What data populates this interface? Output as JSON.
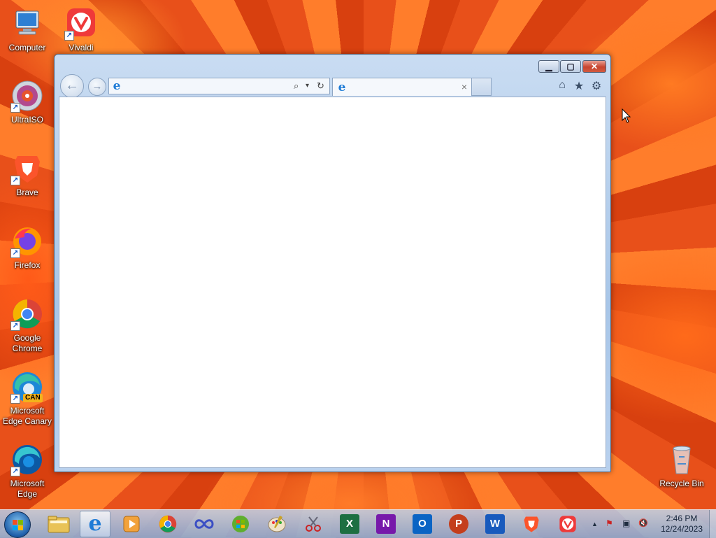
{
  "desktop": {
    "icons": [
      {
        "label": "Computer"
      },
      {
        "label": "Vivaldi"
      },
      {
        "label": "UltraISO"
      },
      {
        "label": "Brave"
      },
      {
        "label": "Firefox"
      },
      {
        "label": "Google Chrome"
      },
      {
        "label": "Microsoft Edge Canary",
        "badge": "CAN"
      },
      {
        "label": "Microsoft Edge"
      },
      {
        "label": "Recycle Bin"
      }
    ]
  },
  "browser": {
    "address_value": "",
    "tab_title": "",
    "new_tab_label": "",
    "buttons": {
      "minimize": "▁",
      "maximize": "▢",
      "close": "✕",
      "back": "←",
      "forward": "→",
      "search": "⌕",
      "dropdown": "▾",
      "refresh": "↻",
      "tab_close": "×",
      "home": "⌂",
      "favorites": "★",
      "tools": "⚙"
    }
  },
  "taskbar": {
    "apps": [
      {
        "name": "Windows Explorer"
      },
      {
        "name": "Internet Explorer"
      },
      {
        "name": "Windows Media Player"
      },
      {
        "name": "Google Chrome"
      },
      {
        "name": "Infinity"
      },
      {
        "name": "Windows Live"
      },
      {
        "name": "Paint"
      },
      {
        "name": "Snipping Tool"
      },
      {
        "name": "Excel",
        "letter": "X",
        "color": "#1d6f42"
      },
      {
        "name": "OneNote",
        "letter": "N",
        "color": "#7719aa"
      },
      {
        "name": "Outlook",
        "letter": "O",
        "color": "#0a64c4"
      },
      {
        "name": "PowerPoint",
        "letter": "P",
        "color": "#c43e1c"
      },
      {
        "name": "Word",
        "letter": "W",
        "color": "#185abd"
      },
      {
        "name": "Brave"
      },
      {
        "name": "Vivaldi"
      }
    ],
    "tray": {
      "arrow": "▲",
      "flag": "⚑",
      "network": "▣",
      "volume": "🔇"
    },
    "clock": {
      "time": "2:46 PM",
      "date": "12/24/2023"
    }
  }
}
